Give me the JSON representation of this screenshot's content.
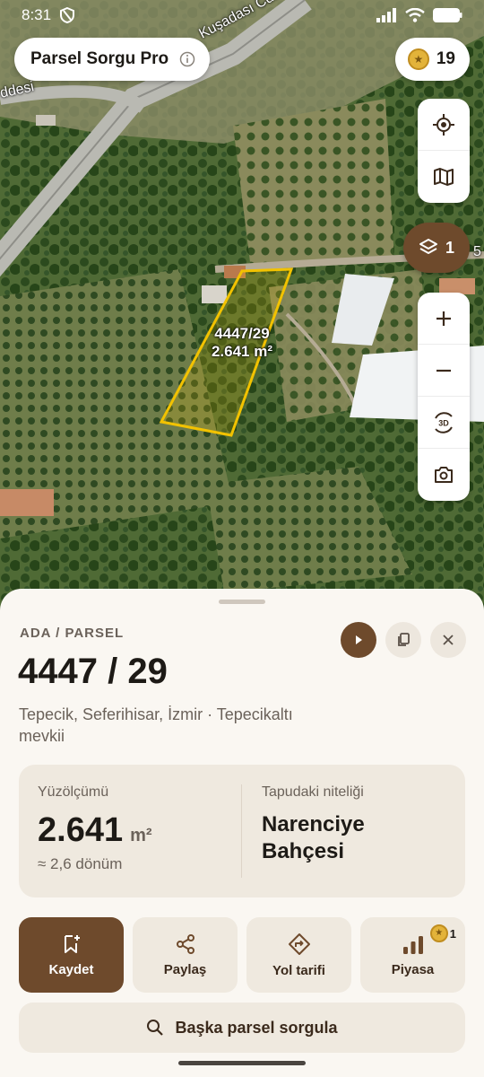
{
  "status_bar": {
    "time": "8:31",
    "icons": [
      "shield-icon",
      "signal-icon",
      "wifi-icon",
      "battery-icon"
    ]
  },
  "map": {
    "road_labels": [
      "Kuşadası Cd.",
      "ddesi",
      "5"
    ],
    "parcel_label": {
      "number": "4447/29",
      "area": "2.641 m²"
    },
    "parcel_outline_color": "#f2c200"
  },
  "header": {
    "app_title": "Parsel Sorgu Pro",
    "info_icon": "info-icon",
    "coin_count": "19",
    "coin_icon": "coin-icon"
  },
  "map_controls": {
    "top_group": [
      "locate-icon",
      "map-icon"
    ],
    "layers_count": "1",
    "zoom_group": [
      "zoom-in-icon",
      "zoom-out-icon",
      "3d-rotate-icon",
      "camera-icon"
    ]
  },
  "sheet": {
    "overline": "ADA / PARSEL",
    "parcel_number": "4447 / 29",
    "location": "Tepecik, Seferihisar, İzmir · Tepecikaltı mevkii",
    "area_label": "Yüzölçümü",
    "area_value": "2.641",
    "area_unit": "m²",
    "area_donum": "≈ 2,6 dönüm",
    "quality_label": "Tapudaki niteliği",
    "quality_value": "Narenciye Bahçesi",
    "actions": [
      {
        "label": "Kaydet",
        "icon": "bookmark-add-icon"
      },
      {
        "label": "Paylaş",
        "icon": "share-icon"
      },
      {
        "label": "Yol tarifi",
        "icon": "directions-icon"
      },
      {
        "label": "Piyasa",
        "icon": "bar-chart-icon",
        "badge": "1"
      }
    ],
    "search_label": "Başka parsel sorgula"
  },
  "colors": {
    "primary_brown": "#6e4a2c",
    "sheet_bg": "#faf7f2",
    "card_bg": "#efe9df"
  }
}
